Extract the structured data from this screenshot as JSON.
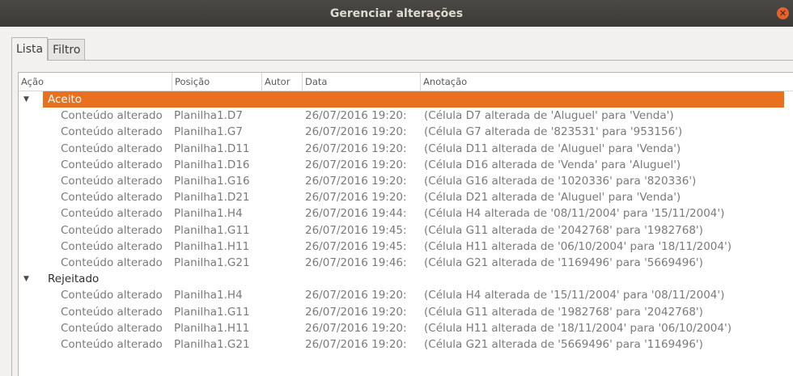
{
  "window": {
    "title": "Gerenciar alterações"
  },
  "tabs": [
    "Lista",
    "Filtro"
  ],
  "columns": [
    "Ação",
    "Posição",
    "Autor",
    "Data",
    "Anotação"
  ],
  "groups": [
    {
      "label": "Aceito",
      "selected": true,
      "rows": [
        [
          "Conteúdo alterado",
          "Planilha1.D7",
          "",
          "26/07/2016 19:20:",
          "(Célula D7 alterada de 'Aluguel' para 'Venda')"
        ],
        [
          "Conteúdo alterado",
          "Planilha1.G7",
          "",
          "26/07/2016 19:20:",
          "(Célula G7 alterada de '823531' para '953156')"
        ],
        [
          "Conteúdo alterado",
          "Planilha1.D11",
          "",
          "26/07/2016 19:20:",
          "(Célula D11 alterada de 'Aluguel' para 'Venda')"
        ],
        [
          "Conteúdo alterado",
          "Planilha1.D16",
          "",
          "26/07/2016 19:20:",
          "(Célula D16 alterada de 'Venda' para 'Aluguel')"
        ],
        [
          "Conteúdo alterado",
          "Planilha1.G16",
          "",
          "26/07/2016 19:20:",
          "(Célula G16 alterada de '1020336' para '820336')"
        ],
        [
          "Conteúdo alterado",
          "Planilha1.D21",
          "",
          "26/07/2016 19:20:",
          "(Célula D21 alterada de 'Aluguel' para 'Venda')"
        ],
        [
          "Conteúdo alterado",
          "Planilha1.H4",
          "",
          "26/07/2016 19:44:",
          "(Célula H4 alterada de '08/11/2004' para '15/11/2004')"
        ],
        [
          "Conteúdo alterado",
          "Planilha1.G11",
          "",
          "26/07/2016 19:45:",
          "(Célula G11 alterada de '2042768' para '1982768')"
        ],
        [
          "Conteúdo alterado",
          "Planilha1.H11",
          "",
          "26/07/2016 19:45:",
          "(Célula H11 alterada de '06/10/2004' para '18/11/2004')"
        ],
        [
          "Conteúdo alterado",
          "Planilha1.G21",
          "",
          "26/07/2016 19:46:",
          "(Célula G21 alterada de '1169496' para '5669496')"
        ]
      ]
    },
    {
      "label": "Rejeitado",
      "selected": false,
      "rows": [
        [
          "Conteúdo alterado",
          "Planilha1.H4",
          "",
          "26/07/2016 19:20:",
          "(Célula H4 alterada de '15/11/2004' para '08/11/2004')"
        ],
        [
          "Conteúdo alterado",
          "Planilha1.G11",
          "",
          "26/07/2016 19:20:",
          "(Célula G11 alterada de '1982768' para '2042768')"
        ],
        [
          "Conteúdo alterado",
          "Planilha1.H11",
          "",
          "26/07/2016 19:20:",
          "(Célula H11 alterada de '18/11/2004' para '06/10/2004')"
        ],
        [
          "Conteúdo alterado",
          "Planilha1.G21",
          "",
          "26/07/2016 19:20:",
          "(Célula G21 alterada de '5669496' para '1169496')"
        ]
      ]
    }
  ],
  "colors": {
    "selection": "#e9701f",
    "titlebar": "#3b3a36"
  },
  "icons": {
    "close": "close-icon",
    "expand": "triangle-down-icon"
  }
}
